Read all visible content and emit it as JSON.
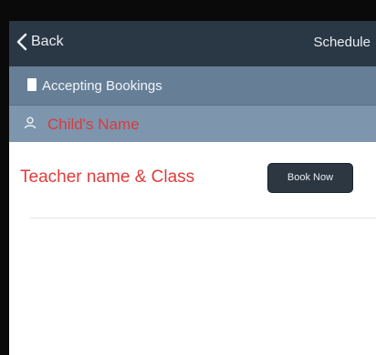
{
  "navbar": {
    "back_label": "Back",
    "back_icon": "chevron-left-icon",
    "schedule_label": "Schedule"
  },
  "status": {
    "icon": "document-icon",
    "label": "Accepting Bookings"
  },
  "child": {
    "icon": "person-icon",
    "placeholder": "Child's Name"
  },
  "teacher_row": {
    "label": "Teacher name & Class",
    "book_button": "Book Now"
  },
  "colors": {
    "navbar": "#2a3744",
    "status_bar": "#667f97",
    "child_bar": "#7d95ad",
    "accent_red": "#e23b3b",
    "button": "#2c3742"
  }
}
